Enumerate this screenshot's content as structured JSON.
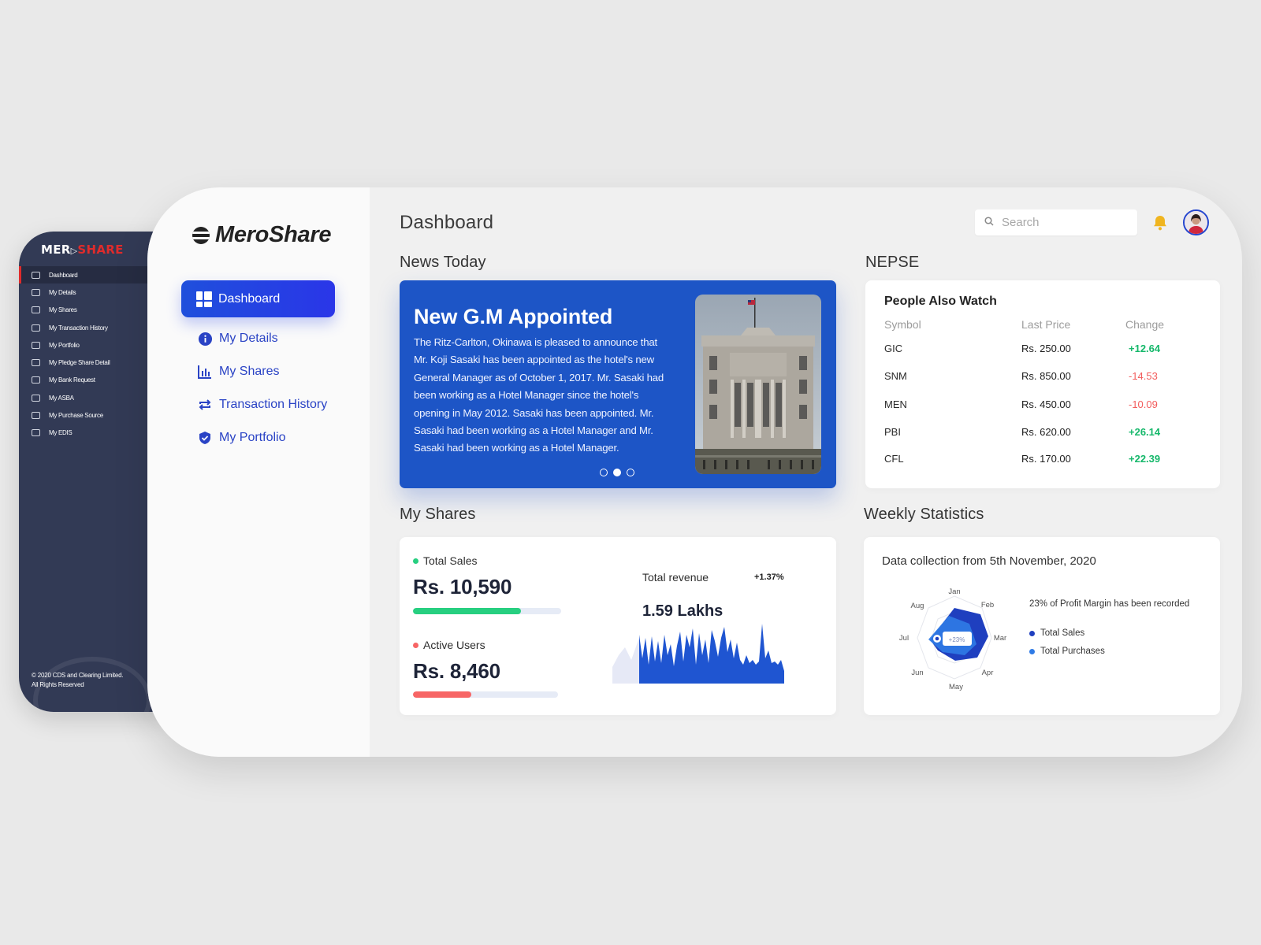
{
  "old_app": {
    "logo_white": "MER",
    "logo_red": "SHARE",
    "items": [
      {
        "label": "Dashboard",
        "active": true
      },
      {
        "label": "My Details"
      },
      {
        "label": "My Shares"
      },
      {
        "label": "My Transaction History"
      },
      {
        "label": "My Portfolio"
      },
      {
        "label": "My Pledge Share Detail"
      },
      {
        "label": "My Bank Request"
      },
      {
        "label": "My ASBA"
      },
      {
        "label": "My Purchase Source"
      },
      {
        "label": "My EDIS"
      }
    ],
    "footer_line1": "© 2020 CDS and Clearing Limited.",
    "footer_line2": "All Rights Reserved"
  },
  "brand": "MeroShare",
  "nav": {
    "dashboard": "Dashboard",
    "my_details": "My Details",
    "my_shares": "My Shares",
    "transaction_history": "Transaction History",
    "my_portfolio": "My Portfolio"
  },
  "header": {
    "title": "Dashboard",
    "search_placeholder": "Search"
  },
  "news": {
    "section_title": "News Today",
    "headline": "New G.M Appointed",
    "body": "The Ritz-Carlton, Okinawa is pleased to announce that Mr. Koji Sasaki has been appointed as the hotel's new General Manager as of October 1, 2017. Mr. Sasaki had been working as a Hotel Manager since the hotel's opening in May 2012. Sasaki has been appointed. Mr. Sasaki had been working as a Hotel Manager and Mr. Sasaki had been working as a Hotel Manager.",
    "active_slide": 2,
    "slide_count": 3
  },
  "nepse": {
    "section_title": "NEPSE",
    "panel_title": "People Also Watch",
    "headers": {
      "symbol": "Symbol",
      "price": "Last Price",
      "change": "Change"
    },
    "rows": [
      {
        "symbol": "GIC",
        "price": "Rs. 250.00",
        "change": "+12.64",
        "up": true
      },
      {
        "symbol": "SNM",
        "price": "Rs. 850.00",
        "change": "-14.53",
        "up": false
      },
      {
        "symbol": "MEN",
        "price": "Rs. 450.00",
        "change": "-10.09",
        "up": false
      },
      {
        "symbol": "PBI",
        "price": "Rs. 620.00",
        "change": "+26.14",
        "up": true
      },
      {
        "symbol": "CFL",
        "price": "Rs. 170.00",
        "change": "+22.39",
        "up": true
      }
    ],
    "up_color": "#16b86b",
    "down_color": "#f25c5c"
  },
  "my_shares": {
    "section_title": "My Shares",
    "total_sales_label": "Total Sales",
    "total_sales_value": "Rs. 10,590",
    "total_sales_progress": 0.73,
    "active_users_label": "Active Users",
    "active_users_value": "Rs. 8,460",
    "active_users_progress": 0.4,
    "revenue_label": "Total revenue",
    "revenue_change": "+1.37%",
    "revenue_value": "1.59 Lakhs",
    "sales_color": "#27cf80",
    "users_color": "#f76565"
  },
  "weekly": {
    "section_title": "Weekly Statistics",
    "subtitle": "Data collection from 5th November, 2020",
    "note": "23% of Profit Margin has been recorded",
    "badge": "+23%",
    "months": [
      "Jan",
      "Feb",
      "Mar",
      "Apr",
      "May",
      "Jun",
      "Jul",
      "Aug"
    ],
    "legend": [
      {
        "label": "Total Sales",
        "color": "#1f3fbf"
      },
      {
        "label": "Total Purchases",
        "color": "#2f7be6"
      }
    ]
  }
}
